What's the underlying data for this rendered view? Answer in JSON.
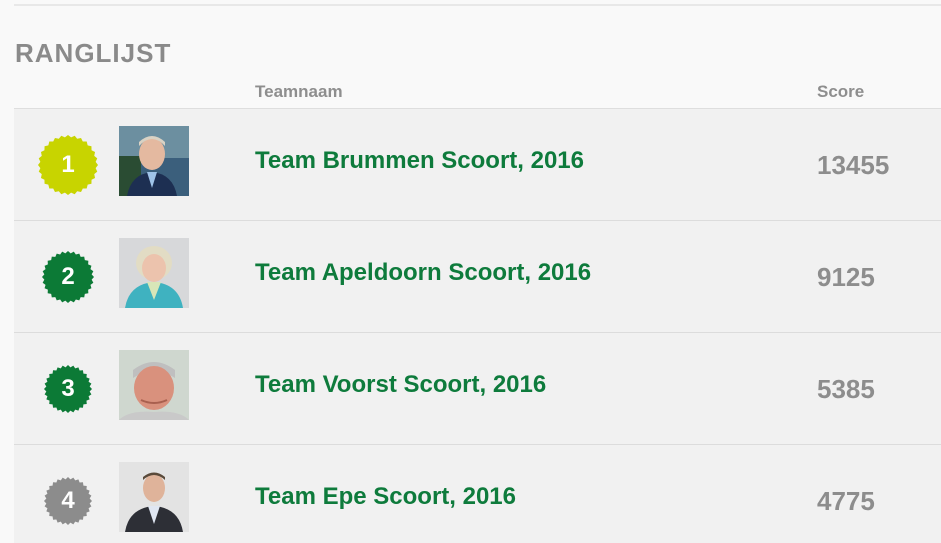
{
  "title": "RANGLIJST",
  "columns": {
    "team": "Teamnaam",
    "score": "Score"
  },
  "colors": {
    "brand_green": "#0e7b3c",
    "first_place": "#c8d400",
    "podium": "#0c7a36",
    "other": "#8c8c8c"
  },
  "rows": [
    {
      "rank": "1",
      "team": "Team Brummen Scoort, 2016",
      "score": "13455",
      "badge_color": "#c8d400"
    },
    {
      "rank": "2",
      "team": "Team Apeldoorn Scoort, 2016",
      "score": "9125",
      "badge_color": "#0c7a36"
    },
    {
      "rank": "3",
      "team": "Team Voorst Scoort, 2016",
      "score": "5385",
      "badge_color": "#0c7a36"
    },
    {
      "rank": "4",
      "team": "Team Epe Scoort, 2016",
      "score": "4775",
      "badge_color": "#8c8c8c"
    }
  ]
}
